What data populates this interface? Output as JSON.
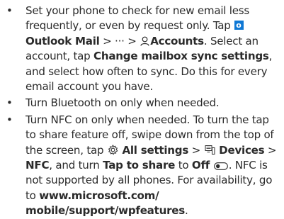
{
  "bullet_char": "•",
  "items": [
    {
      "segments": [
        "Set your phone to check for new email less frequently, or even by request only. Tap ",
        "Outlook Mail",
        " > ··· > ",
        "Accounts",
        ". Select an account, tap ",
        "Change mailbox sync settings",
        ", and select how often to sync. Do this for every email account you have."
      ],
      "icons": [
        "outlook-icon",
        "person-icon"
      ]
    },
    {
      "segments": [
        "Turn Bluetooth on only when needed."
      ]
    },
    {
      "segments": [
        "Turn NFC on only when needed. To turn the tap to share feature off, swipe down from the top of the screen, tap ",
        "All settings",
        " > ",
        "Devices",
        " > ",
        "NFC",
        ", and turn ",
        "Tap to share",
        " to ",
        "Off",
        ". NFC is not supported by all phones. For availability, go to ",
        "www.microsoft.com/ mobile/support/wpfeatures",
        "."
      ],
      "icons": [
        "settings-gear-icon",
        "devices-icon",
        "toggle-off-icon"
      ]
    }
  ]
}
